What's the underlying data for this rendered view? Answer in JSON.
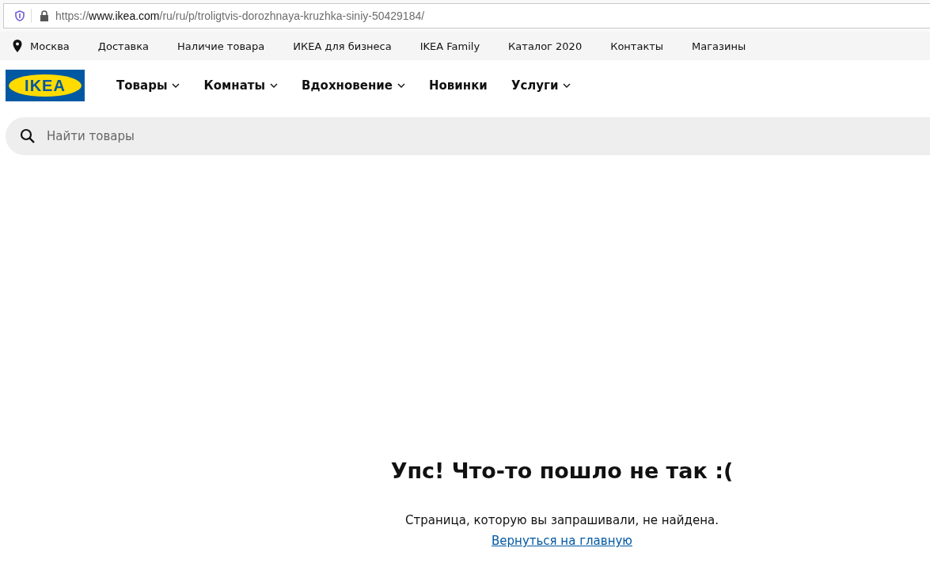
{
  "browser": {
    "url": {
      "prefix": "https://",
      "domain": "www.ikea.com",
      "path": "/ru/ru/p/troligtvis-dorozhnaya-kruzhka-siniy-50429184/"
    }
  },
  "top_bar": {
    "location": "Москва",
    "links": [
      "Доставка",
      "Наличие товара",
      "ИКЕА для бизнеса",
      "IKEA Family",
      "Каталог 2020",
      "Контакты",
      "Магазины"
    ]
  },
  "header": {
    "logo": "IKEA",
    "nav": [
      {
        "label": "Товары",
        "has_dropdown": true
      },
      {
        "label": "Комнаты",
        "has_dropdown": true
      },
      {
        "label": "Вдохновение",
        "has_dropdown": true
      },
      {
        "label": "Новинки",
        "has_dropdown": false
      },
      {
        "label": "Услуги",
        "has_dropdown": true
      }
    ]
  },
  "search": {
    "placeholder": "Найти товары"
  },
  "error": {
    "title": "Упс! Что-то пошло не так :(",
    "message": "Страница, которую вы запрашивали, не найдена.",
    "link": "Вернуться на главную"
  }
}
